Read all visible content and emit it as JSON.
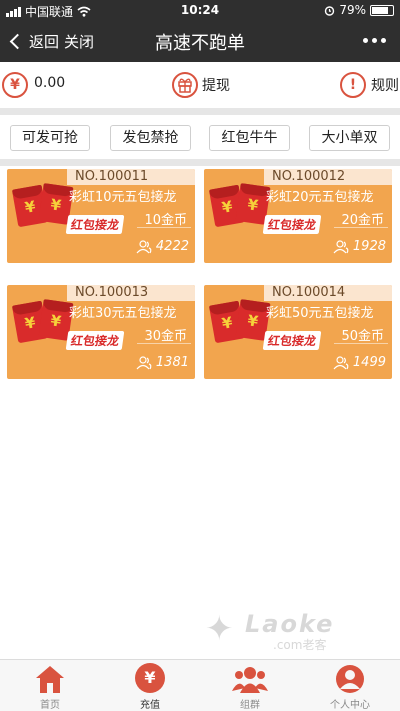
{
  "status_bar": {
    "carrier": "中国联通",
    "time": "10:24",
    "battery": "79%",
    "battery_level": 0.79
  },
  "nav": {
    "back_label": "返回",
    "close_label": "关闭",
    "title": "高速不跑单"
  },
  "info_row": {
    "balance_icon": "¥",
    "balance": "0.00",
    "withdraw_label": "提现",
    "rules_icon": "!",
    "rules_label": "规则"
  },
  "tabs": [
    {
      "label": "可发可抢"
    },
    {
      "label": "发包禁抢"
    },
    {
      "label": "红包牛牛"
    },
    {
      "label": "大小单双"
    }
  ],
  "rooms": [
    {
      "no": "NO.100011",
      "name": "彩虹10元五包接龙",
      "price": "10金币",
      "users": "4222",
      "tag": "红包接龙",
      "coin": "¥"
    },
    {
      "no": "NO.100012",
      "name": "彩虹20元五包接龙",
      "price": "20金币",
      "users": "1928",
      "tag": "红包接龙",
      "coin": "¥"
    },
    {
      "no": "NO.100013",
      "name": "彩虹30元五包接龙",
      "price": "30金币",
      "users": "1381",
      "tag": "红包接龙",
      "coin": "¥"
    },
    {
      "no": "NO.100014",
      "name": "彩虹50元五包接龙",
      "price": "50金币",
      "users": "1499",
      "tag": "红包接龙",
      "coin": "¥"
    }
  ],
  "watermark": {
    "brand": "Laoke",
    "sub": ".com老客"
  },
  "bottom_nav": [
    {
      "label": "首页",
      "icon": "home-icon"
    },
    {
      "label": "充值",
      "icon": "yuan-icon",
      "glyph": "¥"
    },
    {
      "label": "组群",
      "icon": "group-icon"
    },
    {
      "label": "个人中心",
      "icon": "user-icon"
    }
  ],
  "colors": {
    "accent": "#d9533f",
    "card": "#f2a54e",
    "navbar": "#2f2f2f"
  }
}
